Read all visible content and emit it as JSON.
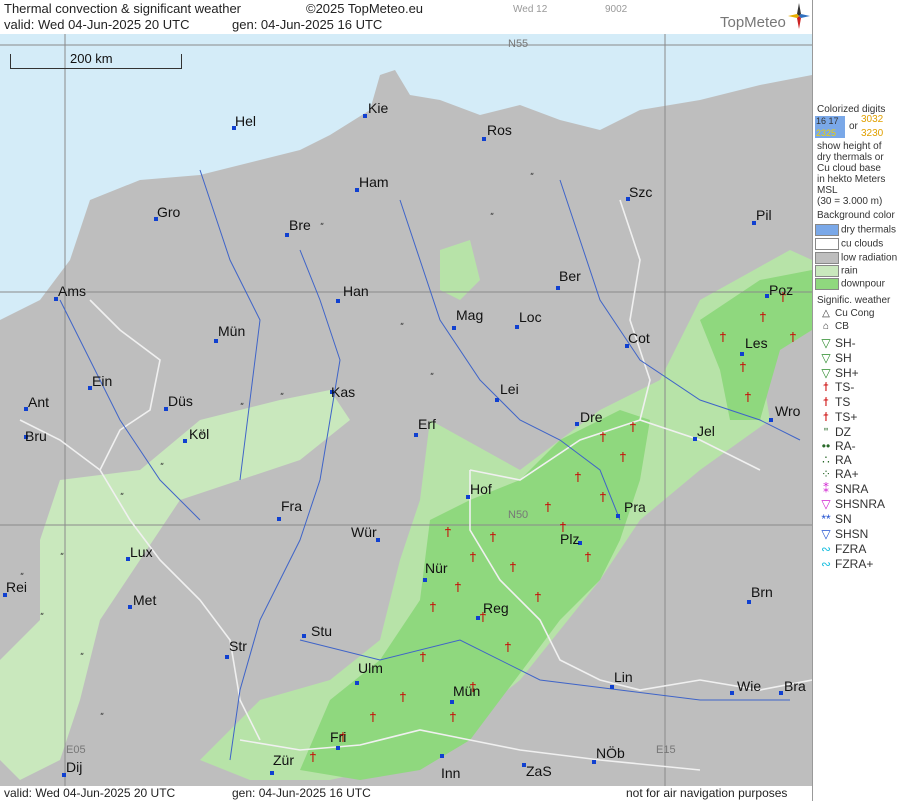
{
  "header": {
    "title": "Thermal convection & significant weather",
    "copyright": "©2025 TopMeteo.eu",
    "day": "Wed 12",
    "code": "9002",
    "valid": "valid:  Wed  04-Jun-2025  20 UTC",
    "gen": "gen: 04-Jun-2025 16 UTC",
    "logo": "TopMeteo"
  },
  "footer": {
    "valid": "valid:  Wed  04-Jun-2025  20 UTC",
    "gen": "gen: 04-Jun-2025 16 UTC",
    "note": "not for air navigation purposes"
  },
  "map": {
    "scale": "200 km",
    "grid_labels": [
      "N55",
      "N50",
      "E05",
      "E15"
    ],
    "cities": [
      "Hel",
      "Kie",
      "Ros",
      "Ham",
      "Szc",
      "Gro",
      "Bre",
      "Pil",
      "Ber",
      "Ams",
      "Han",
      "Mag",
      "Loc",
      "Poz",
      "Mün",
      "Cot",
      "Les",
      "Ein",
      "Kas",
      "Lei",
      "Ant",
      "Düs",
      "Wro",
      "Bru",
      "Köl",
      "Erf",
      "Dre",
      "Jel",
      "Hof",
      "Fra",
      "Pra",
      "Lux",
      "Wür",
      "Plz",
      "Rei",
      "Met",
      "Nür",
      "Brn",
      "Reg",
      "Stu",
      "Str",
      "Ulm",
      "Lin",
      "Wie",
      "Bra",
      "Mün",
      "Fri",
      "Dij",
      "Zür",
      "Inn",
      "ZaS",
      "NÖb"
    ],
    "colors": {
      "sea": "#d4ecf8",
      "land": "#bebebe",
      "rain": "#b7e3a8",
      "downpour": "#7fd670",
      "rivers": "#4468c8",
      "borders": "#f2f2f2",
      "storm": "#cc0000"
    }
  },
  "legend": {
    "digits_title": "Colorized digits",
    "digits_a": "16 17",
    "digits_b": "3032",
    "digits_or": "or",
    "digits_c": "2325",
    "digits_d": "3230",
    "digits_text": [
      "show height of",
      "dry thermals or",
      "Cu cloud base",
      "in hekto Meters",
      "MSL",
      "(30 = 3.000 m)"
    ],
    "bg_title": "Background color",
    "bg_items": [
      "dry thermals",
      "cu clouds",
      "low radiation",
      "rain",
      "downpour"
    ],
    "sig_title": "Signific. weather",
    "sig_items": [
      "Cu Cong",
      "CB",
      "SH-",
      "SH",
      "SH+",
      "TS-",
      "TS",
      "TS+",
      "DZ",
      "RA-",
      "RA",
      "RA+",
      "SNRA",
      "SHSNRA",
      "SN",
      "SHSN",
      "FZRA",
      "FZRA+"
    ]
  }
}
